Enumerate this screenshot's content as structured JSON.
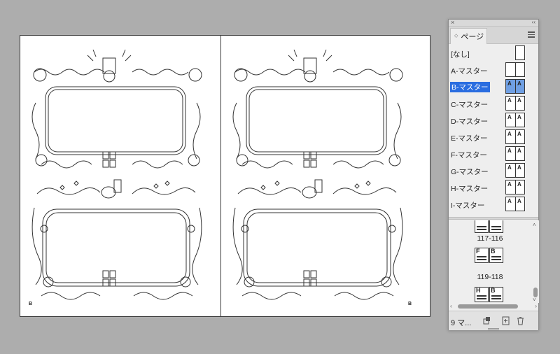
{
  "document": {
    "left_page_letter": "B",
    "right_page_letter": "B"
  },
  "panel": {
    "close_glyph": "×",
    "collapse_glyph": "‹‹",
    "tab_label": "ページ",
    "tab_arrows": "◇",
    "masters": [
      {
        "label": "[なし]",
        "thumb": "single",
        "selected": false
      },
      {
        "label": "A-マスター",
        "thumb": "double",
        "selected": false
      },
      {
        "label": "B-マスター",
        "thumb": "double",
        "letters": [
          "A",
          "A"
        ],
        "selected": true
      },
      {
        "label": "C-マスター",
        "thumb": "double",
        "letters": [
          "A",
          "A"
        ],
        "selected": false
      },
      {
        "label": "D-マスター",
        "thumb": "double",
        "letters": [
          "A",
          "A"
        ],
        "selected": false
      },
      {
        "label": "E-マスター",
        "thumb": "double",
        "letters": [
          "A",
          "A"
        ],
        "selected": false
      },
      {
        "label": "F-マスター",
        "thumb": "double",
        "letters": [
          "A",
          "A"
        ],
        "selected": false
      },
      {
        "label": "G-マスター",
        "thumb": "double",
        "letters": [
          "A",
          "A"
        ],
        "selected": false
      },
      {
        "label": "H-マスター",
        "thumb": "double",
        "letters": [
          "A",
          "A"
        ],
        "selected": false
      },
      {
        "label": "I-マスター",
        "thumb": "double",
        "letters": [
          "A",
          "A"
        ],
        "selected": false
      }
    ],
    "spreads": [
      {
        "label": "117-116",
        "letters": [
          "",
          ""
        ]
      },
      {
        "label": "119-118",
        "letters": [
          "F",
          "B"
        ]
      },
      {
        "label": "",
        "letters": [
          "H",
          "B"
        ]
      }
    ],
    "footer": {
      "count": "9 マ..."
    },
    "scroll": {
      "up": "˄",
      "down": "˅",
      "left": "‹",
      "right": "›"
    }
  },
  "colors": {
    "selection": "#2a6de0",
    "selected_thumb": "#6f9fe3",
    "canvas": "#adadad"
  }
}
